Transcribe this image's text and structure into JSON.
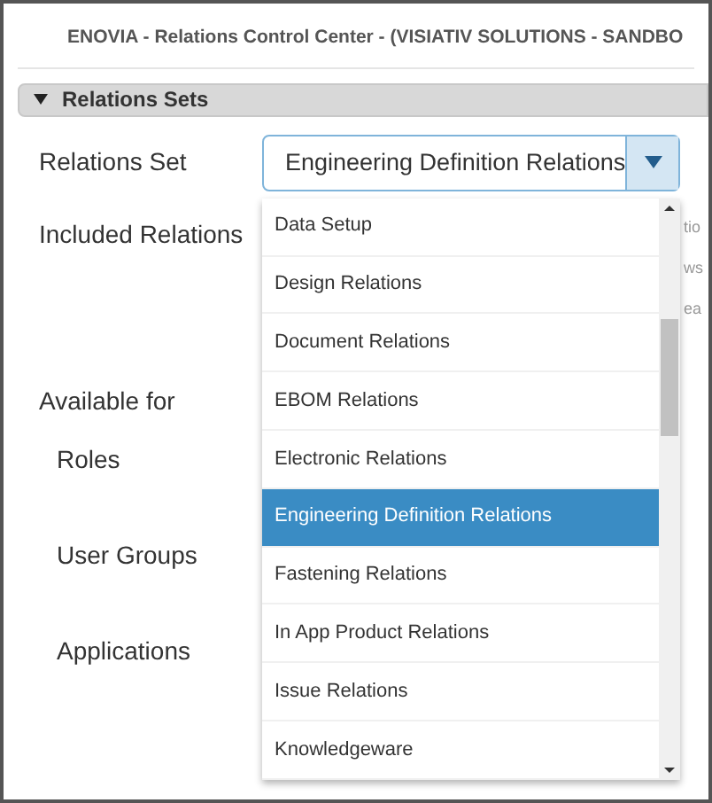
{
  "window": {
    "title": "ENOVIA - Relations Control Center - (VISIATIV SOLUTIONS - SANDBO"
  },
  "section": {
    "title": "Relations Sets",
    "expanded": true
  },
  "relations_set": {
    "label": "Relations Set",
    "value": "Engineering Definition Relations",
    "expanded": true,
    "options": [
      {
        "label": "Data Setup",
        "selected": false
      },
      {
        "label": "Design Relations",
        "selected": false
      },
      {
        "label": "Document Relations",
        "selected": false
      },
      {
        "label": "EBOM Relations",
        "selected": false
      },
      {
        "label": "Electronic Relations",
        "selected": false
      },
      {
        "label": "Engineering Definition Relations",
        "selected": true
      },
      {
        "label": "Fastening Relations",
        "selected": false
      },
      {
        "label": "In App Product Relations",
        "selected": false
      },
      {
        "label": "Issue Relations",
        "selected": false
      },
      {
        "label": "Knowledgeware",
        "selected": false
      }
    ]
  },
  "included_relations": {
    "label": "Included Relations",
    "hidden_fragments": [
      "tio",
      "ws",
      "ea"
    ]
  },
  "available_for": {
    "label": "Available for",
    "items": [
      "Roles",
      "User Groups",
      "Applications"
    ]
  }
}
